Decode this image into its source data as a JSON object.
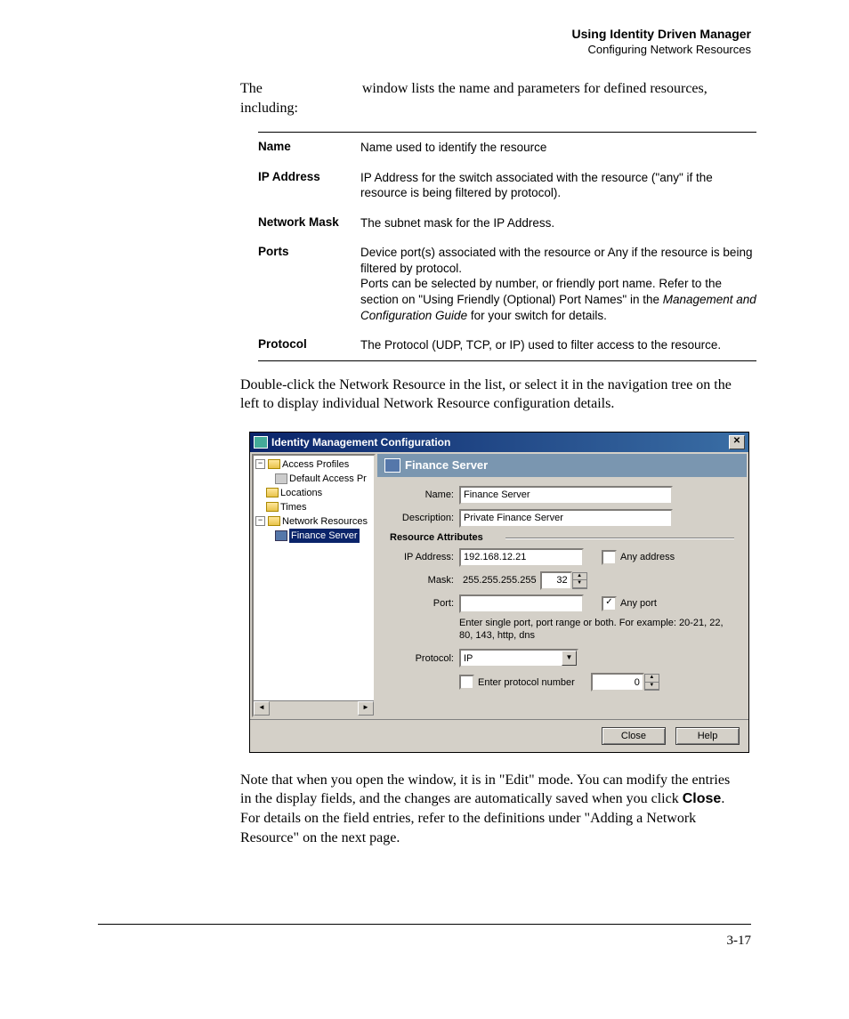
{
  "header": {
    "title": "Using Identity Driven Manager",
    "subtitle": "Configuring Network Resources"
  },
  "intro": {
    "prefix": "The",
    "suffix": "window lists the name and parameters for defined resources, including:"
  },
  "definitions": [
    {
      "term": "Name",
      "desc": "Name used to identify the resource"
    },
    {
      "term": "IP Address",
      "desc": "IP Address for the switch associated with the resource (\"any\" if the resource is being filtered by protocol)."
    },
    {
      "term": "Network Mask",
      "desc": "The subnet mask for the IP Address."
    },
    {
      "term": "Ports",
      "desc_pre": "Device port(s) associated with the resource or Any if the resource is being filtered by protocol.\nPorts can be selected by number, or friendly port name.  Refer to the section on \"Using Friendly (Optional) Port Names\" in the ",
      "desc_italic": "Management and Configuration Guide",
      "desc_post": " for your switch for details."
    },
    {
      "term": "Protocol",
      "desc": "The Protocol (UDP, TCP, or IP) used to filter access to the resource."
    }
  ],
  "mid_text": "Double-click the Network Resource in the list, or select it in the navigation tree on the left to display individual Network Resource configuration details.",
  "window": {
    "title": "Identity Management Configuration",
    "tree": {
      "access_profiles": "Access Profiles",
      "default_access": "Default Access Pr",
      "locations": "Locations",
      "times": "Times",
      "network_resources": "Network Resources",
      "finance_server": "Finance Server"
    },
    "panel": {
      "title": "Finance Server",
      "name_label": "Name:",
      "name_value": "Finance Server",
      "desc_label": "Description:",
      "desc_value": "Private Finance Server",
      "section_label": "Resource Attributes",
      "ip_label": "IP Address:",
      "ip_value": "192.168.12.21",
      "any_address": "Any address",
      "mask_label": "Mask:",
      "mask_value": "255.255.255.255",
      "mask_bits": "32",
      "port_label": "Port:",
      "port_value": "",
      "any_port": "Any port",
      "port_hint": "Enter single port, port range or both. For example: 20-21, 22, 80, 143, http, dns",
      "protocol_label": "Protocol:",
      "protocol_value": "IP",
      "enter_proto": "Enter protocol number",
      "proto_num": "0"
    },
    "buttons": {
      "close": "Close",
      "help": "Help"
    }
  },
  "note": {
    "pre": "Note that when you open the window, it is in \"Edit\" mode. You can modify the entries in the display fields, and the changes are automatically saved when you click ",
    "bold": "Close",
    "post": ". For details on the field entries, refer to the definitions under \"Adding a Network Resource\" on the next page."
  },
  "page_number": "3-17"
}
